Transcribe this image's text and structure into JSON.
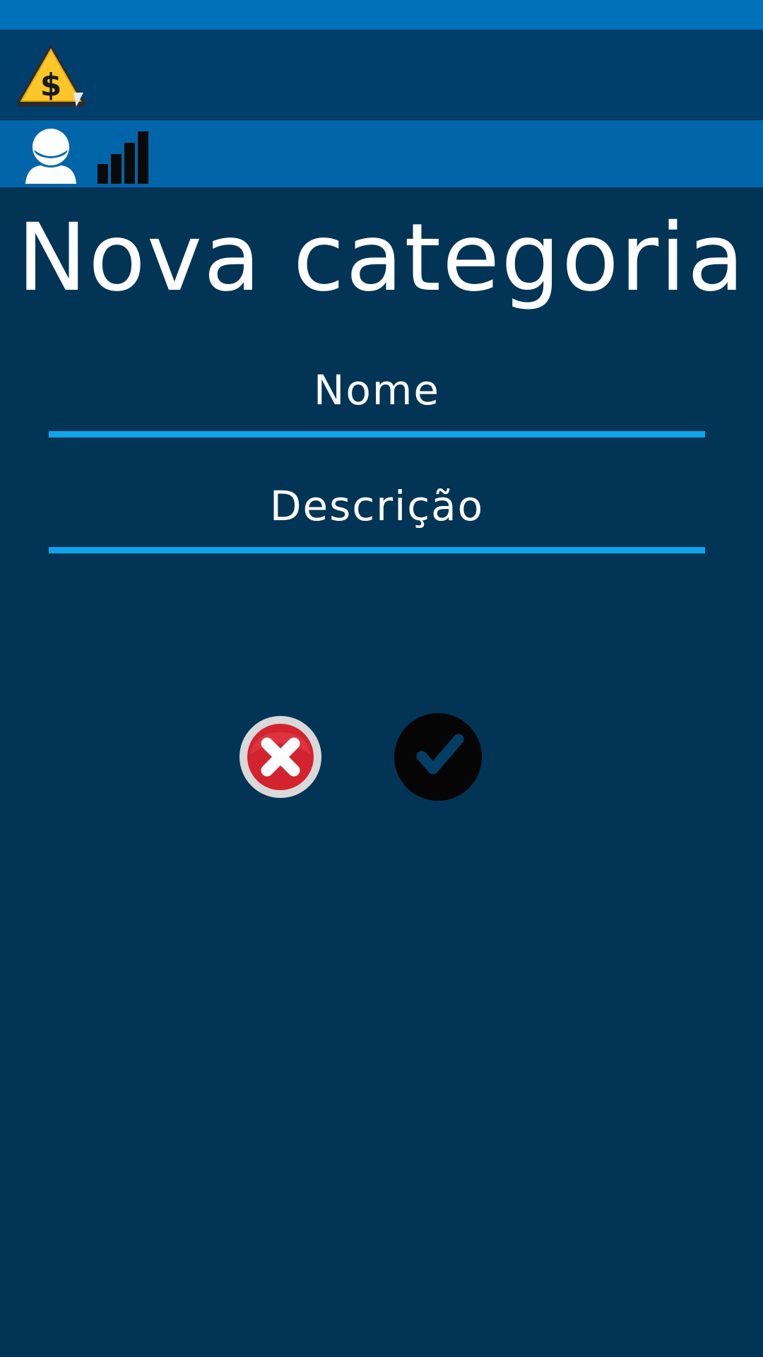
{
  "header": {
    "logo_icon": "dollar-warning-sign-icon"
  },
  "toolbar": {
    "user_icon": "user-icon",
    "stats_icon": "signal-bars-icon"
  },
  "page": {
    "title": "Nova categoria"
  },
  "form": {
    "nome": {
      "placeholder": "Nome",
      "value": ""
    },
    "descricao": {
      "placeholder": "Descrição",
      "value": ""
    }
  },
  "actions": {
    "cancel_icon": "cancel-x-icon",
    "confirm_icon": "confirm-check-icon"
  },
  "colors": {
    "background": "#023456",
    "status_bar": "#0070b8",
    "header": "#003f6b",
    "toolbar": "#0166a9",
    "field_underline": "#0ea4ec",
    "cancel_red": "#d3232e",
    "logo_yellow": "#fcc629"
  }
}
